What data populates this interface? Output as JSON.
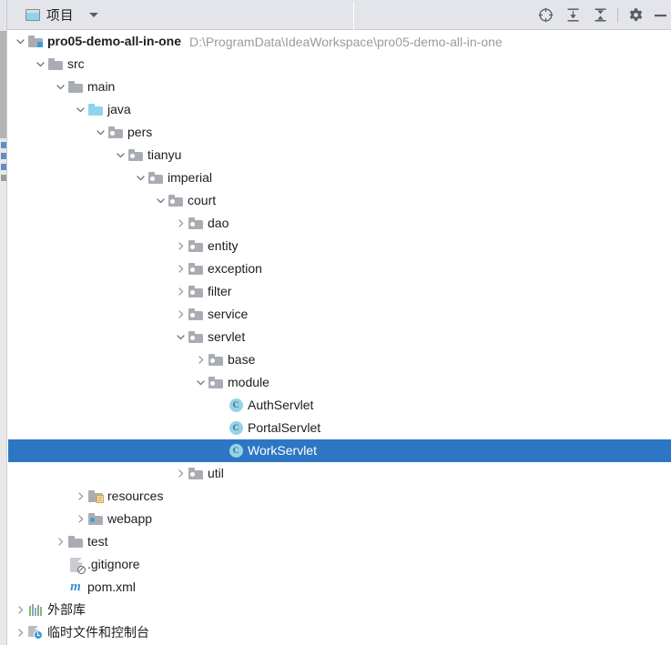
{
  "window": {
    "tool_window": "项目"
  },
  "toolbar": {
    "tab_label": "项目",
    "tab_icon": "project-window-icon",
    "dropdown_icon": "chevron-down-icon",
    "actions": [
      {
        "name": "select-opened-file-icon",
        "label": "Select Opened File"
      },
      {
        "name": "expand-all-icon",
        "label": "Expand All"
      },
      {
        "name": "collapse-all-icon",
        "label": "Collapse All"
      },
      {
        "name": "settings-gear-icon",
        "label": "Settings"
      },
      {
        "name": "hide-icon",
        "label": "Hide"
      }
    ]
  },
  "colors": {
    "selection": "#2d76c4",
    "toolbar_bg": "#e3e5ea",
    "path_text": "#9b9b9b",
    "folder_gray": "#a9adb3",
    "folder_blue": "#8fd4ee",
    "class_icon": "#96d3e8",
    "maven_blue": "#3d8fd1"
  },
  "tree": {
    "rows": [
      {
        "label": "pro05-demo-all-in-one",
        "path": "D:\\ProgramData\\IdeaWorkspace\\pro05-demo-all-in-one",
        "indent": 0,
        "twisty": "expanded",
        "icon": "project-folder-icon",
        "bold": true,
        "selected": false
      },
      {
        "label": "src",
        "path": "",
        "indent": 1,
        "twisty": "expanded",
        "icon": "folder-icon",
        "bold": false,
        "selected": false
      },
      {
        "label": "main",
        "path": "",
        "indent": 2,
        "twisty": "expanded",
        "icon": "folder-icon",
        "bold": false,
        "selected": false
      },
      {
        "label": "java",
        "path": "",
        "indent": 3,
        "twisty": "expanded",
        "icon": "source-root-folder-icon",
        "bold": false,
        "selected": false
      },
      {
        "label": "pers",
        "path": "",
        "indent": 4,
        "twisty": "expanded",
        "icon": "package-icon",
        "bold": false,
        "selected": false
      },
      {
        "label": "tianyu",
        "path": "",
        "indent": 5,
        "twisty": "expanded",
        "icon": "package-icon",
        "bold": false,
        "selected": false
      },
      {
        "label": "imperial",
        "path": "",
        "indent": 6,
        "twisty": "expanded",
        "icon": "package-icon",
        "bold": false,
        "selected": false
      },
      {
        "label": "court",
        "path": "",
        "indent": 7,
        "twisty": "expanded",
        "icon": "package-icon",
        "bold": false,
        "selected": false
      },
      {
        "label": "dao",
        "path": "",
        "indent": 8,
        "twisty": "collapsed",
        "icon": "package-icon",
        "bold": false,
        "selected": false
      },
      {
        "label": "entity",
        "path": "",
        "indent": 8,
        "twisty": "collapsed",
        "icon": "package-icon",
        "bold": false,
        "selected": false
      },
      {
        "label": "exception",
        "path": "",
        "indent": 8,
        "twisty": "collapsed",
        "icon": "package-icon",
        "bold": false,
        "selected": false
      },
      {
        "label": "filter",
        "path": "",
        "indent": 8,
        "twisty": "collapsed",
        "icon": "package-icon",
        "bold": false,
        "selected": false
      },
      {
        "label": "service",
        "path": "",
        "indent": 8,
        "twisty": "collapsed",
        "icon": "package-icon",
        "bold": false,
        "selected": false
      },
      {
        "label": "servlet",
        "path": "",
        "indent": 8,
        "twisty": "expanded",
        "icon": "package-icon",
        "bold": false,
        "selected": false
      },
      {
        "label": "base",
        "path": "",
        "indent": 9,
        "twisty": "collapsed",
        "icon": "package-icon",
        "bold": false,
        "selected": false
      },
      {
        "label": "module",
        "path": "",
        "indent": 9,
        "twisty": "expanded",
        "icon": "package-icon",
        "bold": false,
        "selected": false
      },
      {
        "label": "AuthServlet",
        "path": "",
        "indent": 10,
        "twisty": "none",
        "icon": "java-class-icon",
        "bold": false,
        "selected": false
      },
      {
        "label": "PortalServlet",
        "path": "",
        "indent": 10,
        "twisty": "none",
        "icon": "java-class-icon",
        "bold": false,
        "selected": false
      },
      {
        "label": "WorkServlet",
        "path": "",
        "indent": 10,
        "twisty": "none",
        "icon": "java-class-icon",
        "bold": false,
        "selected": true
      },
      {
        "label": "util",
        "path": "",
        "indent": 8,
        "twisty": "collapsed",
        "icon": "package-icon",
        "bold": false,
        "selected": false
      },
      {
        "label": "resources",
        "path": "",
        "indent": 3,
        "twisty": "collapsed",
        "icon": "resource-root-folder-icon",
        "bold": false,
        "selected": false
      },
      {
        "label": "webapp",
        "path": "",
        "indent": 3,
        "twisty": "collapsed",
        "icon": "webapp-folder-icon",
        "bold": false,
        "selected": false
      },
      {
        "label": "test",
        "path": "",
        "indent": 2,
        "twisty": "collapsed",
        "icon": "folder-icon",
        "bold": false,
        "selected": false
      },
      {
        "label": ".gitignore",
        "path": "",
        "indent": 2,
        "twisty": "none",
        "icon": "gitignore-file-icon",
        "bold": false,
        "selected": false
      },
      {
        "label": "pom.xml",
        "path": "",
        "indent": 2,
        "twisty": "none",
        "icon": "maven-pom-icon",
        "bold": false,
        "selected": false
      },
      {
        "label": "外部库",
        "path": "",
        "indent": 0,
        "twisty": "collapsed",
        "icon": "external-libraries-icon",
        "bold": false,
        "selected": false
      },
      {
        "label": "临时文件和控制台",
        "path": "",
        "indent": 0,
        "twisty": "collapsed",
        "icon": "scratches-consoles-icon",
        "bold": false,
        "selected": false
      }
    ]
  }
}
